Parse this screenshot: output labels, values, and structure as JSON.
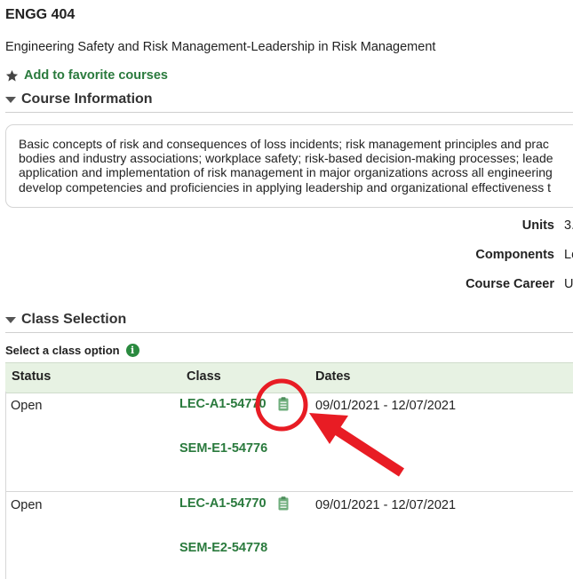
{
  "course": {
    "code": "ENGG 404",
    "title": "Engineering Safety and Risk Management-Leadership in Risk Management",
    "favorite_label": "Add to favorite courses"
  },
  "course_information": {
    "heading": "Course Information",
    "description_lines": [
      "Basic concepts of risk and consequences of loss incidents; risk management principles and prac",
      "bodies and industry associations; workplace safety; risk-based decision-making processes; leade",
      "application and implementation of risk management in major organizations across all engineering",
      "develop competencies and proficiencies in applying leadership and organizational effectiveness t"
    ],
    "units_label": "Units",
    "units_value": "3.",
    "components_label": "Components",
    "components_value": "Le",
    "career_label": "Course Career",
    "career_value": "U"
  },
  "class_selection": {
    "heading": "Class Selection",
    "select_label": "Select a class option",
    "columns": [
      "Status",
      "Class",
      "Dates"
    ],
    "rows": [
      {
        "status": "Open",
        "lec": "LEC-A1-54770",
        "sem": "SEM-E1-54776",
        "dates": "09/01/2021 - 12/07/2021"
      },
      {
        "status": "Open",
        "lec": "LEC-A1-54770",
        "sem": "SEM-E2-54778",
        "dates": "09/01/2021 - 12/07/2021"
      }
    ]
  },
  "icons": {
    "favorite": "star-icon",
    "collapse": "triangle-down-icon",
    "info": "info-icon",
    "class_details": "clipboard-icon",
    "annotation": "red-circle-and-arrow"
  },
  "colors": {
    "link_green": "#2a7a3d",
    "header_green": "#e7f2e3",
    "annotation_red": "#e81c24"
  }
}
